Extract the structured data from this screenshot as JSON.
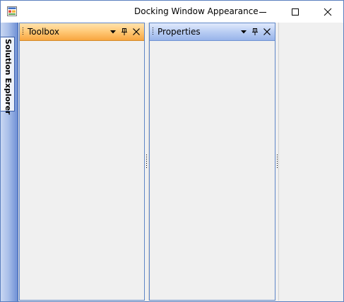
{
  "window": {
    "title": "Docking Window Appearance",
    "icons": {
      "app": "app-window-icon",
      "minimize": "minimize-icon",
      "maximize": "maximize-icon",
      "close": "close-icon"
    }
  },
  "autohide": {
    "tabs": [
      {
        "label": "Solution Explorer"
      }
    ]
  },
  "panes": [
    {
      "title": "Toolbox",
      "active": true
    },
    {
      "title": "Properties",
      "active": false
    }
  ],
  "colors": {
    "active_caption": "#ffc876",
    "inactive_caption": "#b9cdf3",
    "frame": "#5a7fbf",
    "strip": "#6d8fd5"
  }
}
